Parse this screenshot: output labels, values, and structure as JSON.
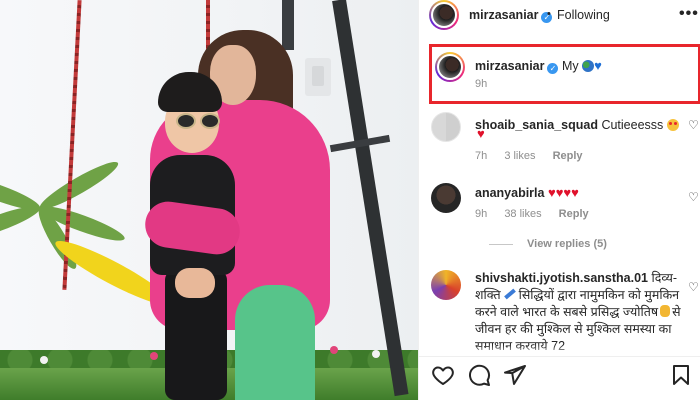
{
  "post": {
    "author": "mirzasaniar",
    "follow_status": "Following",
    "more_glyph": "•••",
    "separator": "•"
  },
  "caption": {
    "username": "mirzasaniar",
    "text": "My",
    "emojis": [
      "globe-icon",
      "blue-heart-icon"
    ],
    "time": "9h",
    "highlight_color": "#e8262c"
  },
  "comments": [
    {
      "username": "shoaib_sania_squad",
      "text": "Cutieeesss",
      "emojis": [
        "starstruck-face-icon",
        "red-heart-icon"
      ],
      "time": "7h",
      "likes": "3 likes",
      "reply": "Reply"
    },
    {
      "username": "ananyabirla",
      "text": "",
      "emojis": [
        "red-heart-icon",
        "red-heart-icon",
        "red-heart-icon",
        "red-heart-icon"
      ],
      "time": "9h",
      "likes": "38 likes",
      "reply": "Reply",
      "view_replies": "View replies (5)"
    },
    {
      "username": "shivshakti.jyotish.sanstha.01",
      "text_line1": "दिव्य-",
      "text_line2": "शक्ति",
      "text_rest": "सिद्धियों द्वारा नामुमकिन को मुमकिन करने वाले भारत के सबसे प्रसिद्ध ज्योतिष",
      "text_end": "से जीवन हर की मुश्किल से मुश्किल समस्या का समाधान करवाये 72"
    }
  ],
  "icons": [
    "heart-outline-icon",
    "comment-icon",
    "share-icon",
    "bookmark-icon"
  ],
  "colors": {
    "verified": "#3897f0",
    "text": "#262626",
    "muted": "#8e8e8e",
    "heart": "#e0112b"
  }
}
